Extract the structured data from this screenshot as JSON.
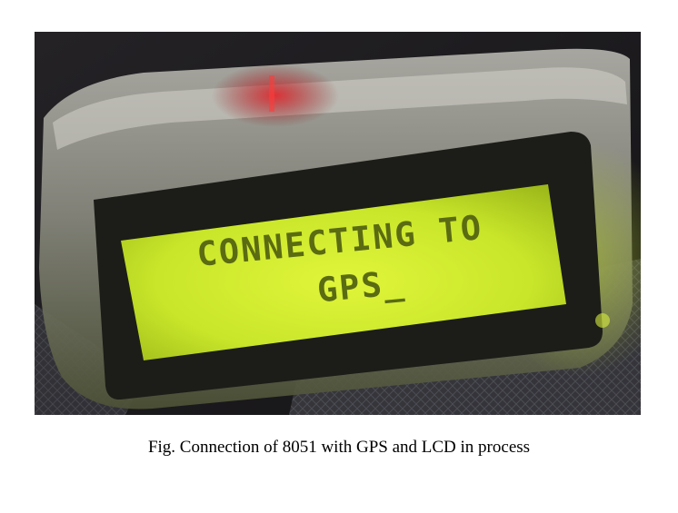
{
  "photo": {
    "subject": "lcd-module-photo",
    "lcd_line_1": "CONNECTING TO",
    "lcd_line_2": "GPS_",
    "colors": {
      "lcd_backlight": "#c9e62a",
      "lcd_text": "#5a6b12",
      "enclosure": "#8e9088",
      "background": "#1b1a1c",
      "red_glow": "#c0161b"
    }
  },
  "caption": {
    "text": "Fig. Connection of 8051 with GPS and LCD in process"
  }
}
